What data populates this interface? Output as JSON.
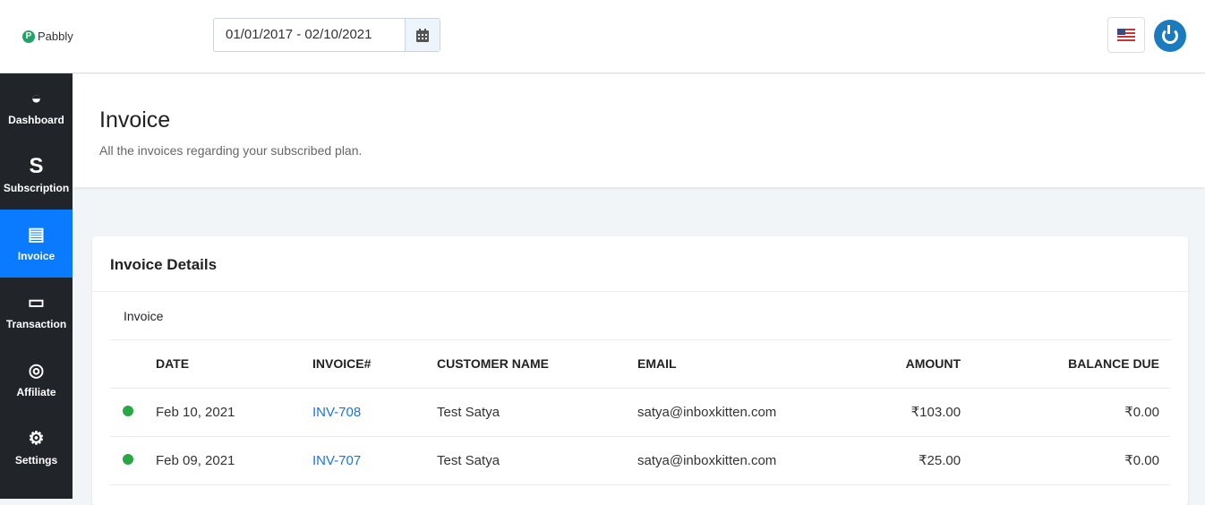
{
  "header": {
    "logo": "Pabbly",
    "date_range": "01/01/2017 - 02/10/2021"
  },
  "sidebar": {
    "items": [
      {
        "label": "Dashboard",
        "icon": "dashboard-icon",
        "glyph": "◒"
      },
      {
        "label": "Subscription",
        "icon": "subscription-icon",
        "glyph": "S"
      },
      {
        "label": "Invoice",
        "icon": "invoice-icon",
        "glyph": "▤",
        "active": true
      },
      {
        "label": "Transaction",
        "icon": "money-icon",
        "glyph": "▭"
      },
      {
        "label": "Affiliate",
        "icon": "podcast-icon",
        "glyph": "◎"
      },
      {
        "label": "Settings",
        "icon": "gear-icon",
        "glyph": "⚙"
      }
    ]
  },
  "page": {
    "title": "Invoice",
    "subtitle": "All the invoices regarding your subscribed plan."
  },
  "card": {
    "title": "Invoice Details",
    "tab": "Invoice",
    "columns": [
      "DATE",
      "INVOICE#",
      "CUSTOMER NAME",
      "EMAIL",
      "AMOUNT",
      "BALANCE DUE"
    ],
    "rows": [
      {
        "status": "paid",
        "date": "Feb 10, 2021",
        "invoice": "INV-708",
        "customer": "Test Satya",
        "email": "satya@inboxkitten.com",
        "amount": "₹103.00",
        "balance": "₹0.00"
      },
      {
        "status": "paid",
        "date": "Feb 09, 2021",
        "invoice": "INV-707",
        "customer": "Test Satya",
        "email": "satya@inboxkitten.com",
        "amount": "₹25.00",
        "balance": "₹0.00"
      }
    ]
  },
  "colors": {
    "sidebar": "#212529",
    "active": "#0a7bff",
    "status_paid": "#28a745",
    "link": "#1a73e8"
  }
}
